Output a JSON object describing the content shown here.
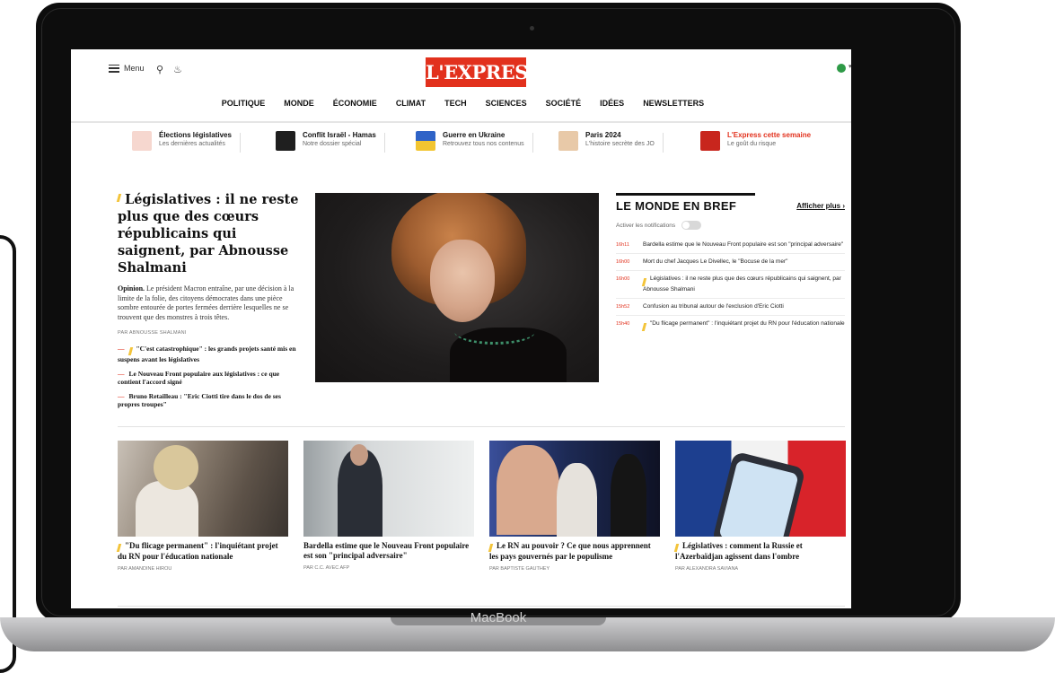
{
  "device": {
    "brand": "MacBook"
  },
  "site": {
    "logo": "L'EXPRESS",
    "menu_label": "Menu",
    "nav": [
      "POLITIQUE",
      "MONDE",
      "ÉCONOMIE",
      "CLIMAT",
      "TECH",
      "SCIENCES",
      "SOCIÉTÉ",
      "IDÉES",
      "NEWSLETTERS"
    ],
    "accent": "#e2311d"
  },
  "quicklinks": [
    {
      "title": "Élections législatives",
      "subtitle": "Les dernières actualités",
      "color": "#f6d7cf"
    },
    {
      "title": "Conflit Israël - Hamas",
      "subtitle": "Notre dossier spécial",
      "color": "#1f1f1f"
    },
    {
      "title": "Guerre en Ukraine",
      "subtitle": "Retrouvez tous nos contenus",
      "color": "#f2c531"
    },
    {
      "title": "Paris 2024",
      "subtitle": "L'histoire secrète des JO",
      "color": "#e8c9a8"
    },
    {
      "title": "L'Express cette semaine",
      "subtitle": "Le goût du risque",
      "color": "#c8261d"
    }
  ],
  "lead": {
    "title": "Législatives : il ne reste plus que des cœurs républicains qui saignent, par Abnousse Shalmani",
    "kicker": "Opinion.",
    "description": "Le président Macron entraîne, par une décision à la limite de la folie, des citoyens démocrates dans une pièce sombre entourée de portes fermées derrière lesquelles ne se trouvent que des monstres à trois têtes.",
    "byline": "PAR ABNOUSSE SHALMANI",
    "related": [
      "\"C'est catastrophique\" : les grands projets santé mis en suspens avant les législatives",
      "Le Nouveau Front populaire aux législatives : ce que contient l'accord signé",
      "Bruno Retailleau : \"Eric Ciotti tire dans le dos de ses propres troupes\""
    ]
  },
  "brief": {
    "title": "LE MONDE EN BREF",
    "more": "Afficher plus ›",
    "notifications": "Activer les notifications",
    "items": [
      {
        "time": "16h11",
        "text": "Bardella estime que le Nouveau Front populaire est son \"principal adversaire\""
      },
      {
        "time": "16h00",
        "text": "Mort du chef Jacques Le Divellec, le \"Bocuse de la mer\""
      },
      {
        "time": "16h00",
        "text": "Législatives : il ne reste plus que des cœurs républicains qui saignent, par Abnousse Shalmani"
      },
      {
        "time": "15h52",
        "text": "Confusion au tribunal autour de l'exclusion d'Eric Ciotti"
      },
      {
        "time": "15h40",
        "text": "\"Du flicage permanent\" : l'inquiétant projet du RN pour l'éducation nationale"
      }
    ]
  },
  "cards": [
    {
      "title": "\"Du flicage permanent\" : l'inquiétant projet du RN pour l'éducation nationale",
      "byline": "PAR AMANDINE HIROU"
    },
    {
      "title": "Bardella estime que le Nouveau Front populaire est son \"principal adversaire\"",
      "byline": "PAR C.C. AVEC AFP"
    },
    {
      "title": "Le RN au pouvoir ? Ce que nous apprennent les pays gouvernés par le populisme",
      "byline": "PAR BAPTISTE GAUTHEY"
    },
    {
      "title": "Législatives : comment la Russie et l'Azerbaïdjan agissent dans l'ombre",
      "byline": "PAR ALEXANDRA SAVIANA"
    }
  ]
}
